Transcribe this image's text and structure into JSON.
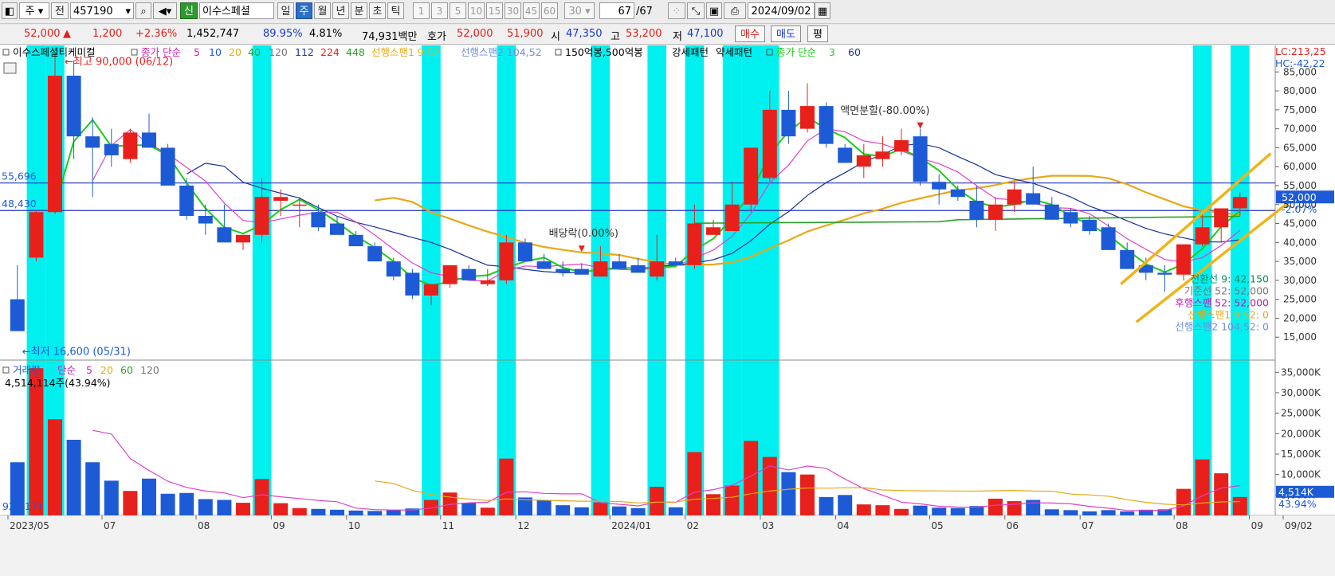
{
  "toolbar": {
    "market": "주",
    "prefix": "전",
    "code": "457190",
    "new_badge": "신",
    "stock_name": "이수스페셜",
    "periods": [
      "일",
      "주",
      "월",
      "년",
      "분",
      "초",
      "틱"
    ],
    "active_period": "주",
    "intervals": [
      "1",
      "3",
      "5",
      "10",
      "15",
      "30",
      "45",
      "60"
    ],
    "interval_value": "30",
    "count": "67",
    "count_total": "/67",
    "date": "2024/09/02"
  },
  "quote": {
    "price": "52,000",
    "arrow": "▲",
    "change": "1,200",
    "change_pct": "+2.36%",
    "volume": "1,452,747",
    "vol_ratio": "89.95%",
    "turnover": "4.81%",
    "amount": "74,931백만",
    "ask_label": "호가",
    "ask": "52,000",
    "bid": "51,900",
    "open_label": "시",
    "open": "47,350",
    "high_label": "고",
    "high": "53,200",
    "low_label": "저",
    "low": "47,100",
    "buy_button": "매수",
    "sell_button": "매도",
    "eval_button": "평"
  },
  "price_legend": {
    "name": "이수스페셜티케미컬",
    "ma_label": "종가 단순",
    "ma_periods": [
      "5",
      "10",
      "20",
      "40",
      "120",
      "112",
      "224",
      "448"
    ],
    "span1": "선행스팬1 9,52",
    "span2": "선행스팬2 104,52",
    "pattern1": "150억봉,500억봉",
    "pattern2": "강세패턴",
    "pattern3": "약세패턴",
    "ma2_label": "종가 단순",
    "ma2_periods": [
      "3",
      "60"
    ]
  },
  "volume_legend": {
    "label": "거래량",
    "ma_label": "단순",
    "ma_periods": [
      "5",
      "20",
      "60",
      "120"
    ],
    "info": "4,514,114주(43.94%)",
    "min_label": "924,171"
  },
  "annotations": {
    "lc": "LC:213,25",
    "hc": "HC:-42,22",
    "high_mark": "최고 90,000 (06/12)",
    "low_mark": "최저 16,600 (05/31)",
    "dividend": "배당락(0.00%)",
    "split": "액면분할(-80.00%)",
    "hline1": "55,696",
    "hline2": "48,430",
    "last_price": "52,000",
    "last_pct": "-2.07%",
    "last_vol": "4,514K",
    "last_vol_pct": "43.94%",
    "ichimoku": [
      "전환선 9: 42,150",
      "기준선 52: 52,000",
      "후행스팬 52: 52,000",
      "선행스팬1 9,52: 0",
      "선행스팬2 104,52: 0"
    ]
  },
  "colors": {
    "up": "#e8201c",
    "down": "#1d5bd6",
    "highlight": "#00f0f0",
    "ma5": "#1ccc1c",
    "ma10": "#e040c8",
    "ma20": "#1a2f9a",
    "ma40": "#e8a817",
    "ma112": "#2aa02a",
    "channel": "#f0b418",
    "axis_bg": "#ffffff"
  },
  "chart_data": {
    "type": "candlestick",
    "xlabel": "",
    "ylabel": "",
    "ylim": [
      10000,
      92000
    ],
    "volume_ylim": [
      0,
      37000
    ],
    "x_ticks": [
      {
        "i": 0,
        "label": "2023/05"
      },
      {
        "i": 5,
        "label": "07"
      },
      {
        "i": 10,
        "label": "08"
      },
      {
        "i": 14,
        "label": "09"
      },
      {
        "i": 18,
        "label": "10"
      },
      {
        "i": 23,
        "label": "11"
      },
      {
        "i": 27,
        "label": "12"
      },
      {
        "i": 32,
        "label": "2024/01"
      },
      {
        "i": 36,
        "label": "02"
      },
      {
        "i": 40,
        "label": "03"
      },
      {
        "i": 44,
        "label": "04"
      },
      {
        "i": 49,
        "label": "05"
      },
      {
        "i": 53,
        "label": "06"
      },
      {
        "i": 57,
        "label": "07"
      },
      {
        "i": 62,
        "label": "08"
      },
      {
        "i": 66,
        "label": "09"
      },
      {
        "i": 69,
        "label": "09/02"
      }
    ],
    "y_ticks": [
      15000,
      20000,
      25000,
      30000,
      35000,
      40000,
      45000,
      50000,
      55000,
      60000,
      65000,
      70000,
      75000,
      80000,
      85000
    ],
    "y_tick_labels": [
      "15,000",
      "20,000",
      "25,000",
      "30,000",
      "35,000",
      "40,000",
      "45,000",
      "50,000",
      "55,000",
      "60,000",
      "65,000",
      "70,000",
      "75,000",
      "80,000",
      "85,000"
    ],
    "vol_ticks": [
      5000,
      10000,
      15000,
      20000,
      25000,
      30000,
      35000
    ],
    "vol_tick_labels": [
      "5,000K",
      "10,000K",
      "15,000K",
      "20,000K",
      "25,000K",
      "30,000K",
      "35,000K"
    ],
    "highlight_weeks": [
      1,
      2,
      13,
      22,
      26,
      31,
      34,
      36,
      38,
      39,
      40,
      63,
      65
    ],
    "candles": [
      [
        25000,
        34000,
        16600,
        16600,
        13000
      ],
      [
        36000,
        48500,
        35000,
        48000,
        36000
      ],
      [
        48000,
        90000,
        47500,
        84000,
        23500
      ],
      [
        84000,
        88000,
        62000,
        68000,
        18500
      ],
      [
        68000,
        73000,
        52000,
        65000,
        13000
      ],
      [
        66000,
        70000,
        60000,
        63000,
        8500
      ],
      [
        62000,
        70000,
        61000,
        69000,
        6000
      ],
      [
        69000,
        74000,
        65000,
        65000,
        9000
      ],
      [
        65000,
        66000,
        56000,
        55000,
        5300
      ],
      [
        55000,
        57000,
        46000,
        47000,
        5500
      ],
      [
        47000,
        50000,
        42000,
        45000,
        4000
      ],
      [
        44000,
        50000,
        42000,
        40000,
        3800
      ],
      [
        40000,
        42000,
        38000,
        42000,
        3100
      ],
      [
        42000,
        57000,
        40000,
        52000,
        8900
      ],
      [
        51000,
        54000,
        47000,
        52000,
        3000
      ],
      [
        50000,
        52000,
        44000,
        50000,
        1800
      ],
      [
        48000,
        50000,
        43000,
        44000,
        1600
      ],
      [
        45000,
        47000,
        42000,
        42000,
        1400
      ],
      [
        42000,
        43000,
        39000,
        39000,
        1200
      ],
      [
        39000,
        40000,
        35000,
        35000,
        1100
      ],
      [
        35000,
        36000,
        30000,
        31000,
        1300
      ],
      [
        32000,
        33000,
        25000,
        26000,
        1700
      ],
      [
        26000,
        29000,
        23500,
        29000,
        3800
      ],
      [
        29000,
        34000,
        28000,
        34000,
        5600
      ],
      [
        33000,
        34000,
        30000,
        30000,
        3100
      ],
      [
        29000,
        33000,
        28500,
        30000,
        1900
      ],
      [
        30000,
        42000,
        29000,
        40000,
        13900
      ],
      [
        40000,
        41000,
        35000,
        35000,
        4400
      ],
      [
        35000,
        37000,
        33000,
        33000,
        3700
      ],
      [
        33000,
        35000,
        31000,
        32000,
        2500
      ],
      [
        33000,
        34500,
        31500,
        31500,
        2000
      ],
      [
        31000,
        39000,
        31000,
        35000,
        3200
      ],
      [
        35000,
        37000,
        33000,
        33000,
        2200
      ],
      [
        34000,
        36000,
        32000,
        32000,
        1800
      ],
      [
        31000,
        42000,
        30000,
        35000,
        7000
      ],
      [
        35000,
        36000,
        34000,
        34000,
        2000
      ],
      [
        34000,
        50000,
        33000,
        45000,
        15500
      ],
      [
        42000,
        46000,
        42000,
        44000,
        5200
      ],
      [
        43000,
        56000,
        43000,
        50000,
        7300
      ],
      [
        50000,
        58000,
        48000,
        65000,
        18200
      ],
      [
        57000,
        80000,
        56000,
        75000,
        14300
      ],
      [
        75000,
        80000,
        66000,
        68000,
        10600
      ],
      [
        70000,
        82000,
        69000,
        76000,
        10000
      ],
      [
        76000,
        77000,
        65000,
        66000,
        4500
      ],
      [
        65000,
        66000,
        61000,
        61000,
        5000
      ],
      [
        60000,
        66000,
        57000,
        63000,
        2700
      ],
      [
        62000,
        68000,
        60000,
        64000,
        2500
      ],
      [
        64000,
        70000,
        63000,
        67000,
        1600
      ],
      [
        68000,
        70000,
        55000,
        56000,
        2400
      ],
      [
        56000,
        58000,
        50000,
        54000,
        1900
      ],
      [
        54000,
        55000,
        51000,
        52000,
        1800
      ],
      [
        51000,
        55000,
        44000,
        46000,
        2300
      ],
      [
        46000,
        52000,
        43000,
        50000,
        4100
      ],
      [
        50000,
        56000,
        48000,
        54000,
        3500
      ],
      [
        53000,
        60000,
        50000,
        50000,
        3800
      ],
      [
        50000,
        52000,
        46000,
        46000,
        1500
      ],
      [
        48000,
        49000,
        44000,
        45000,
        1300
      ],
      [
        46000,
        47000,
        42000,
        43000,
        1000
      ],
      [
        44000,
        45000,
        40000,
        38000,
        1300
      ],
      [
        38000,
        40000,
        33000,
        33000,
        1000
      ],
      [
        34000,
        36000,
        30000,
        32000,
        1400
      ],
      [
        32000,
        34000,
        27000,
        31500,
        1500
      ],
      [
        31500,
        36000,
        30000,
        39500,
        6500
      ],
      [
        39500,
        48000,
        39000,
        44000,
        13700
      ],
      [
        44000,
        49000,
        40000,
        49000,
        10300
      ],
      [
        49000,
        53200,
        47100,
        52000,
        4514
      ]
    ]
  }
}
